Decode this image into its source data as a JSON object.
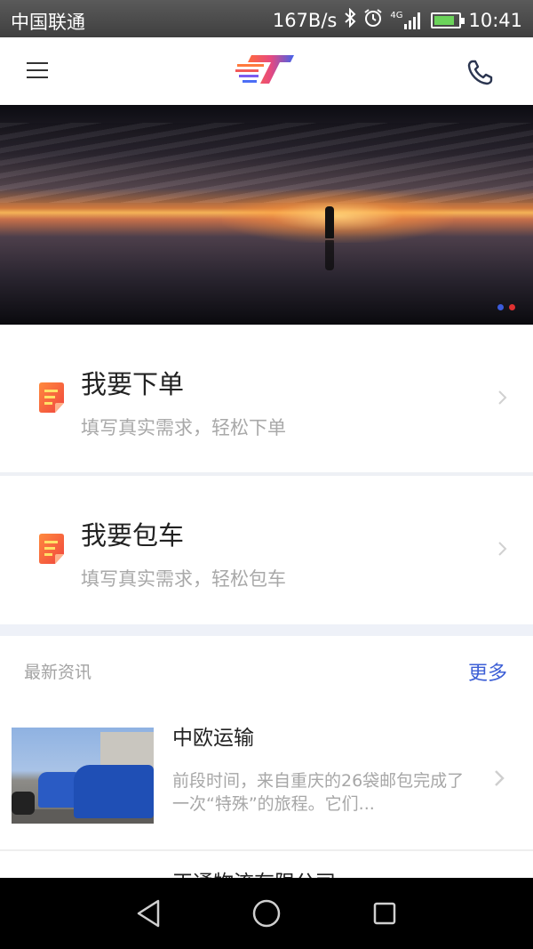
{
  "status_bar": {
    "carrier": "中国联通",
    "speed": "167B/s",
    "network": "4G",
    "time": "10:41"
  },
  "header": {
    "menu_icon": "hamburger-menu-icon",
    "logo": "brand-logo",
    "phone_icon": "phone-icon"
  },
  "banner": {
    "indicator_count": 2,
    "active_index": 0,
    "dot_colors": [
      "#3b5bdb",
      "#e03131"
    ]
  },
  "actions": [
    {
      "title": "我要下单",
      "subtitle": "填写真实需求，轻松下单",
      "icon": "order-document-icon"
    },
    {
      "title": "我要包车",
      "subtitle": "填写真实需求，轻松包车",
      "icon": "charter-document-icon"
    }
  ],
  "news": {
    "label": "最新资讯",
    "more": "更多",
    "items": [
      {
        "title": "中欧运输",
        "desc": "前段时间，来自重庆的26袋邮包完成了一次“特殊”的旅程。它们..."
      }
    ],
    "peek_title": "正通物流有限公司"
  },
  "colors": {
    "accent": "#3d5fd6",
    "icon_red": "#f04f45",
    "icon_orange": "#ff8a3d"
  },
  "nav_bar": {
    "back": "back-icon",
    "home": "home-icon",
    "recent": "recent-apps-icon"
  }
}
